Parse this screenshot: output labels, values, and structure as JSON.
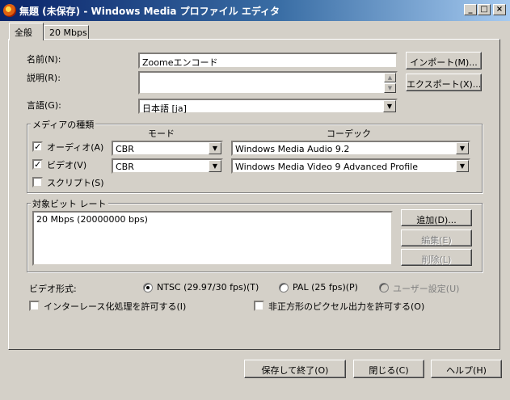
{
  "window": {
    "title": "無題 (未保存) - Windows Media プロファイル エディタ",
    "minimize": "_",
    "maximize": "□",
    "close": "×"
  },
  "tabs": [
    {
      "label": "全般",
      "active": true
    },
    {
      "label": "20 Mbps",
      "active": false
    }
  ],
  "general": {
    "name_label": "名前(N):",
    "name_value": "Zoomeエンコード",
    "description_label": "説明(R):",
    "description_value": "",
    "language_label": "言語(G):",
    "language_value": "日本語 [ja]",
    "import_button": "インポート(M)...",
    "export_button": "エクスポート(X)..."
  },
  "media_types": {
    "group_title": "メディアの種類",
    "mode_header": "モード",
    "codec_header": "コーデック",
    "audio": {
      "label": "オーディオ(A)",
      "checked": true,
      "mode": "CBR",
      "codec": "Windows Media Audio 9.2"
    },
    "video": {
      "label": "ビデオ(V)",
      "checked": true,
      "mode": "CBR",
      "codec": "Windows Media Video 9 Advanced Profile"
    },
    "script": {
      "label": "スクリプト(S)",
      "checked": false
    }
  },
  "bitrates": {
    "group_title": "対象ビット レート",
    "items": [
      "20 Mbps (20000000 bps)"
    ],
    "add_button": "追加(D)...",
    "edit_button": "編集(E)",
    "delete_button": "削除(L)"
  },
  "video_format": {
    "label": "ビデオ形式:",
    "ntsc": "NTSC (29.97/30 fps)(T)",
    "pal": "PAL (25 fps)(P)",
    "custom": "ユーザー設定(U)",
    "selected": "ntsc"
  },
  "options": {
    "interlace": "インターレース化処理を許可する(I)",
    "nonsquare": "非正方形のピクセル出力を許可する(O)"
  },
  "footer": {
    "save_close": "保存して終了(O)",
    "close": "閉じる(C)",
    "help": "ヘルプ(H)"
  }
}
